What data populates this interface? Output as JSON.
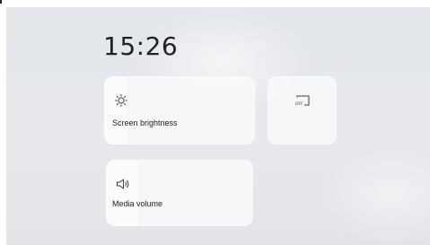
{
  "clock": {
    "time": "15:26"
  },
  "tiles": {
    "brightness": {
      "label": "Screen brightness",
      "icon": "sun-icon",
      "level": 0.15
    },
    "cast": {
      "icon": "cast-off-icon",
      "badge": "OFF"
    },
    "volume": {
      "label": "Media volume",
      "icon": "speaker-icon",
      "level": 0.22
    }
  }
}
